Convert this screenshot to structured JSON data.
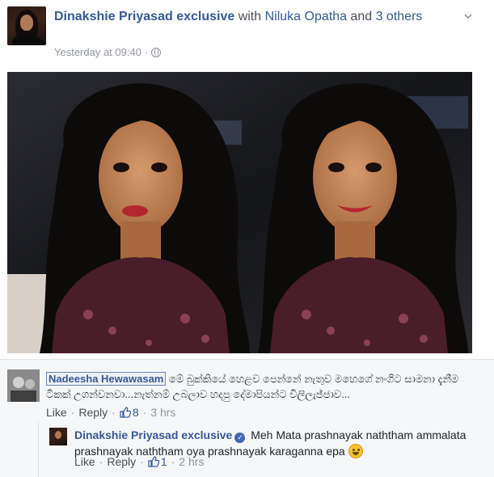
{
  "post": {
    "author": "Dinakshie Priyasad exclusive",
    "with_text": " with ",
    "tagged": "Niluka Opatha",
    "and_text": " and ",
    "others": "3 others",
    "timestamp": "Yesterday at 09:40",
    "separator": "·",
    "privacy_icon": "globe-icon",
    "menu_icon": "chevron-down-icon"
  },
  "photo": {
    "description_icon": "photo"
  },
  "comments": [
    {
      "author": "Nadeesha Hewawasam",
      "text": " මේ බුක්කියේ හෙළව පෙන්නේ නැතුව මහෙගේ නංගිට සාමනා දැනීම ටිකක් උගන්වනවා...නැත්නම් උබලාව හදපු දේමාපියන්ට විලිලැජ්ජාව...",
      "like": "Like",
      "reply": "Reply",
      "reaction_count": "8",
      "time": "3 hrs",
      "dot": "·"
    },
    {
      "author": "Dinakshie Priyasad exclusive",
      "text": " Meh Mata prashnayak naththam ammalata prashnayak naththam oya prashnayak karaganna epa ",
      "like": "Like",
      "reply": "Reply",
      "reaction_count": "1",
      "time": "2 hrs",
      "dot": "·"
    }
  ],
  "colors": {
    "link": "#365899",
    "meta": "#90949c",
    "comment_bg": "#f6f7f9"
  }
}
